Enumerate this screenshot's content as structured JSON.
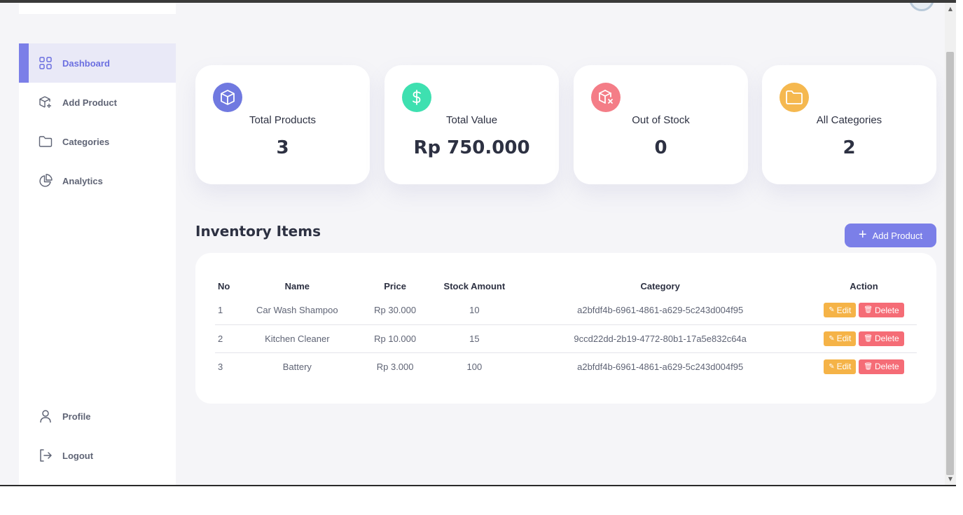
{
  "sidebar": {
    "items": [
      {
        "label": "Dashboard",
        "icon": "grid-icon",
        "active": true
      },
      {
        "label": "Add Product",
        "icon": "box-plus-icon"
      },
      {
        "label": "Categories",
        "icon": "folder-icon"
      },
      {
        "label": "Analytics",
        "icon": "pie-chart-icon"
      }
    ],
    "bottom_items": [
      {
        "label": "Profile",
        "icon": "user-icon"
      },
      {
        "label": "Logout",
        "icon": "logout-icon"
      }
    ]
  },
  "stats": [
    {
      "title": "Total Products",
      "value": "3",
      "icon": "box-icon",
      "color": "#7079e0"
    },
    {
      "title": "Total Value",
      "value": "Rp 750.000",
      "icon": "dollar-icon",
      "color": "#3ee0b0"
    },
    {
      "title": "Out of Stock",
      "value": "0",
      "icon": "box-x-icon",
      "color": "#f47d87"
    },
    {
      "title": "All Categories",
      "value": "2",
      "icon": "folder-icon",
      "color": "#f5b84f"
    }
  ],
  "inventory": {
    "title": "Inventory Items",
    "add_button": "Add Product",
    "columns": [
      "No",
      "Name",
      "Price",
      "Stock Amount",
      "Category",
      "Action"
    ],
    "rows": [
      {
        "no": "1",
        "name": "Car Wash Shampoo",
        "price": "Rp 30.000",
        "stock": "10",
        "category": "a2bfdf4b-6961-4861-a629-5c243d004f95"
      },
      {
        "no": "2",
        "name": "Kitchen Cleaner",
        "price": "Rp 10.000",
        "stock": "15",
        "category": "9ccd22dd-2b19-4772-80b1-17a5e832c64a"
      },
      {
        "no": "3",
        "name": "Battery",
        "price": "Rp 3.000",
        "stock": "100",
        "category": "a2bfdf4b-6961-4861-a629-5c243d004f95"
      }
    ],
    "edit_label": "Edit",
    "delete_label": "Delete"
  },
  "colors": {
    "accent": "#7b7fe8",
    "edit": "#f5b347",
    "delete": "#f56c76",
    "background": "#f5f5f8"
  }
}
